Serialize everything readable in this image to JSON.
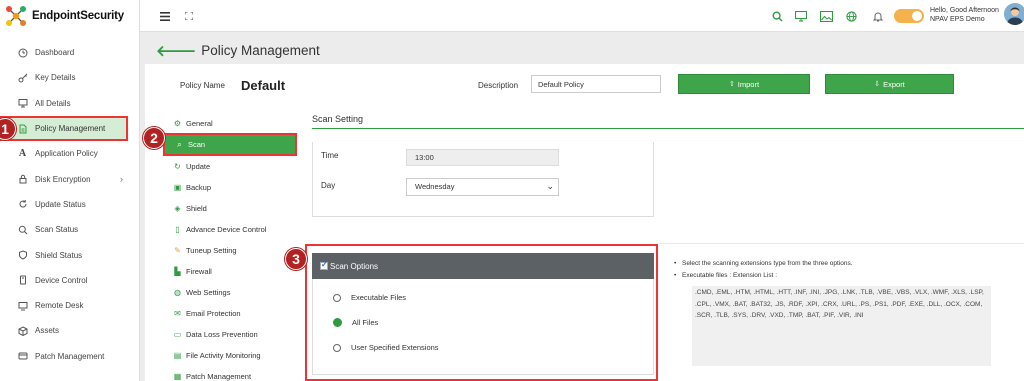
{
  "app": {
    "brand": "EndpointSecurity"
  },
  "sidebar": {
    "items": [
      {
        "label": "Dashboard",
        "icon": "dashboard-icon"
      },
      {
        "label": "Key Details",
        "icon": "key-icon"
      },
      {
        "label": "All Details",
        "icon": "monitor-icon"
      },
      {
        "label": "Policy Management",
        "icon": "document-icon",
        "active": true
      },
      {
        "label": "Application Policy",
        "icon": "font-a-icon"
      },
      {
        "label": "Disk Encryption",
        "icon": "lock-icon",
        "has_children": true
      },
      {
        "label": "Update Status",
        "icon": "refresh-icon"
      },
      {
        "label": "Scan Status",
        "icon": "search-icon"
      },
      {
        "label": "Shield Status",
        "icon": "shield-icon"
      },
      {
        "label": "Device Control",
        "icon": "usb-icon"
      },
      {
        "label": "Remote Desk",
        "icon": "remote-desktop-icon"
      },
      {
        "label": "Assets",
        "icon": "box-icon"
      },
      {
        "label": "Patch Management",
        "icon": "patch-icon"
      }
    ],
    "chevron": "›"
  },
  "topbar": {
    "greeting_line1": "Hello, Good Afternoon",
    "greeting_line2": "NPAV EPS Demo",
    "icons": [
      "hamburger-icon",
      "fullscreen-icon",
      "search-icon",
      "monitor-icon",
      "image-icon",
      "globe-icon",
      "bell-icon",
      "theme-toggle",
      "avatar"
    ]
  },
  "page": {
    "title": "Policy Management",
    "back_arrow": "🡐",
    "policy_name_label": "Policy Name",
    "policy_name_value": "Default",
    "description_label": "Description",
    "description_value": "Default Policy",
    "import_label": "Import",
    "export_label": "Export",
    "import_glyph": "⇧",
    "export_glyph": "⇩"
  },
  "submenu": {
    "items": [
      {
        "label": "General",
        "icon": "gears-icon"
      },
      {
        "label": "Scan",
        "icon": "search-icon",
        "active": true
      },
      {
        "label": "Update",
        "icon": "refresh-icon"
      },
      {
        "label": "Backup",
        "icon": "backup-icon"
      },
      {
        "label": "Shield",
        "icon": "shield-icon"
      },
      {
        "label": "Advance Device Control",
        "icon": "usb-icon"
      },
      {
        "label": "Tuneup Setting",
        "icon": "wrench-icon"
      },
      {
        "label": "Firewall",
        "icon": "firewall-icon"
      },
      {
        "label": "Web Settings",
        "icon": "globe-icon"
      },
      {
        "label": "Email Protection",
        "icon": "email-icon"
      },
      {
        "label": "Data Loss Prevention",
        "icon": "folder-icon"
      },
      {
        "label": "File Activity Monitoring",
        "icon": "file-monitor-icon"
      },
      {
        "label": "Patch Management",
        "icon": "patch-icon"
      }
    ]
  },
  "scan": {
    "section_title": "Scan Setting",
    "time_label": "Time",
    "time_value": "13:00",
    "day_label": "Day",
    "day_value": "Wednesday",
    "day_caret": "⌄",
    "scan_options_title": "Scan Options",
    "options": [
      {
        "label": "Executable Files",
        "selected": false
      },
      {
        "label": "All Files",
        "selected": true
      },
      {
        "label": "User Specified Extensions",
        "selected": false
      }
    ],
    "info_line1": "Select the scanning extensions type from the three options.",
    "info_line2": "Executable files : Extension List :",
    "extension_list_lines": [
      ".CMD, .EML, .HTM, .HTML, .HTT, .INF, .INI, .JPG, .LNK, .TLB, .VBE, .VBS, .VLX, .WMF, .XLS, .LSP,",
      ".CPL, .VMX, .BAT, .BAT32, .JS, .RDF, .XPI, .CRX, .URL, .PS, .PS1, .PDF, .EXE, .DLL, .OCX, .COM,",
      ".SCR, .TLB, .SYS, .DRV, .VXD, .TMP, .BAT, .PIF, .VIR, .INI"
    ]
  },
  "annotations": {
    "badge1": "1",
    "badge2": "2",
    "badge3": "3"
  },
  "colors": {
    "accent_green": "#3fa54a",
    "highlight_red": "#e33",
    "badge_red": "#b22222",
    "header_dark": "#5c6166",
    "toggle_orange": "#f6b24a"
  }
}
